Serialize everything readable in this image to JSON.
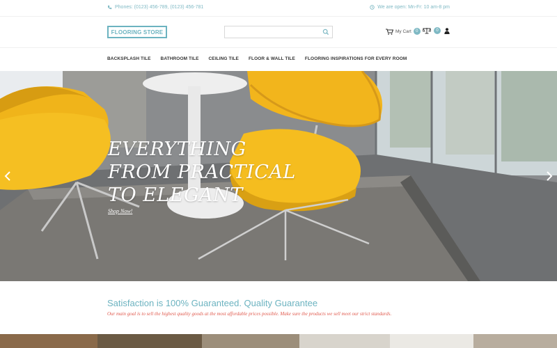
{
  "topbar": {
    "phones": "Phones: (0123) 456-789, (0123) 456-781",
    "hours": "We are open: Mn-Fr: 10 am-8 pm"
  },
  "header": {
    "logo": "FLOORING STORE",
    "search_placeholder": "",
    "cart_label": "My Cart",
    "cart_count": "0",
    "compare_count": "0"
  },
  "nav": {
    "items": [
      "BACKSPLASH TILE",
      "BATHROOM TILE",
      "CEILING TILE",
      "FLOOR & WALL TILE",
      "FLOORING INSPIRATIONS FOR EVERY ROOM"
    ]
  },
  "hero": {
    "line1": "EVERYTHING",
    "line2": "FROM PRACTICAL",
    "line3": "TO ELEGANT",
    "cta": "Shop Now!"
  },
  "guarantee": {
    "title": "Satisfaction is 100% Guaranteed. Quality Guarantee",
    "text": "Our main goal is to sell the highest quality goods at the most affordable prices possible. Make sure the products we sell meet our strict standards."
  },
  "colors": {
    "accent": "#6cb3c0",
    "text_red": "#e05a4e",
    "chair_yellow": "#f2b51c"
  },
  "icons": [
    "phone-icon",
    "clock-icon",
    "search-icon",
    "cart-icon",
    "compare-icon",
    "user-icon",
    "chevron-left-icon",
    "chevron-right-icon"
  ]
}
